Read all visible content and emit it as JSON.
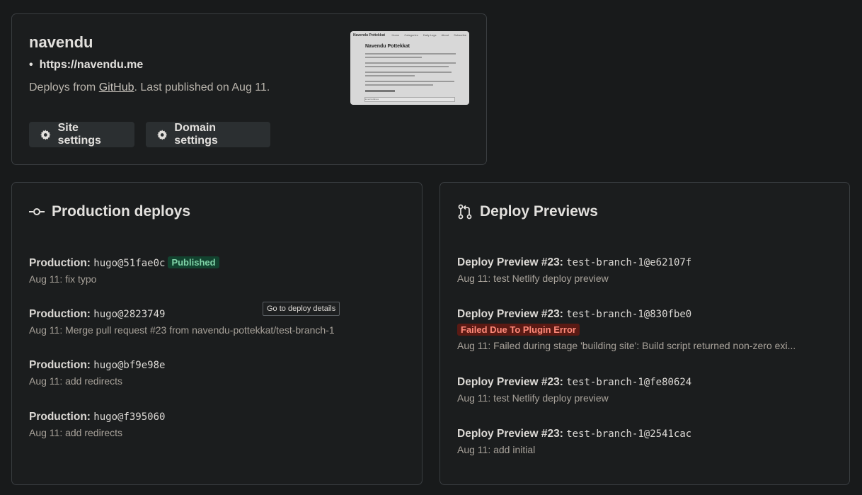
{
  "site": {
    "name": "navendu",
    "url": "https://navendu.me",
    "bullet": "•",
    "deploys_from": "Deploys from",
    "repo_link": "GitHub",
    "published_text": ". Last published on Aug 11.",
    "buttons": {
      "site_settings": "Site settings",
      "domain_settings": "Domain settings"
    },
    "thumbnail": {
      "nav_title": "Navendu Pottekkat",
      "nav_links": [
        "Home",
        "Categories",
        "Daily Logs",
        "About",
        "Subscribe"
      ],
      "page_title": "Navendu Pottekkat",
      "email_box": "Email Address"
    }
  },
  "production": {
    "title": "Production deploys",
    "entries": [
      {
        "label": "Production:",
        "ref": "hugo@51fae0c",
        "badge": "Published",
        "message": "Aug 11: fix typo"
      },
      {
        "label": "Production:",
        "ref": "hugo@2823749",
        "message": "Aug 11: Merge pull request #23 from navendu-pottekkat/test-branch-1"
      },
      {
        "label": "Production:",
        "ref": "hugo@bf9e98e",
        "message": "Aug 11: add redirects"
      },
      {
        "label": "Production:",
        "ref": "hugo@f395060",
        "message": "Aug 11: add redirects"
      }
    ],
    "tooltip": "Go to deploy details"
  },
  "previews": {
    "title": "Deploy Previews",
    "entries": [
      {
        "label": "Deploy Preview #23:",
        "ref": "test-branch-1@e62107f",
        "message": "Aug 11: test Netlify deploy preview"
      },
      {
        "label": "Deploy Preview #23:",
        "ref": "test-branch-1@830fbe0",
        "badge": "Failed Due To Plugin Error",
        "message": "Aug 11: Failed during stage 'building site': Build script returned non-zero exi..."
      },
      {
        "label": "Deploy Preview #23:",
        "ref": "test-branch-1@fe80624",
        "message": "Aug 11: test Netlify deploy preview"
      },
      {
        "label": "Deploy Preview #23:",
        "ref": "test-branch-1@2541cac",
        "message": "Aug 11: add initial"
      }
    ]
  },
  "colors": {
    "background": "#181a1b",
    "published_badge": "#12432f",
    "failed_badge": "#5a1a14"
  }
}
